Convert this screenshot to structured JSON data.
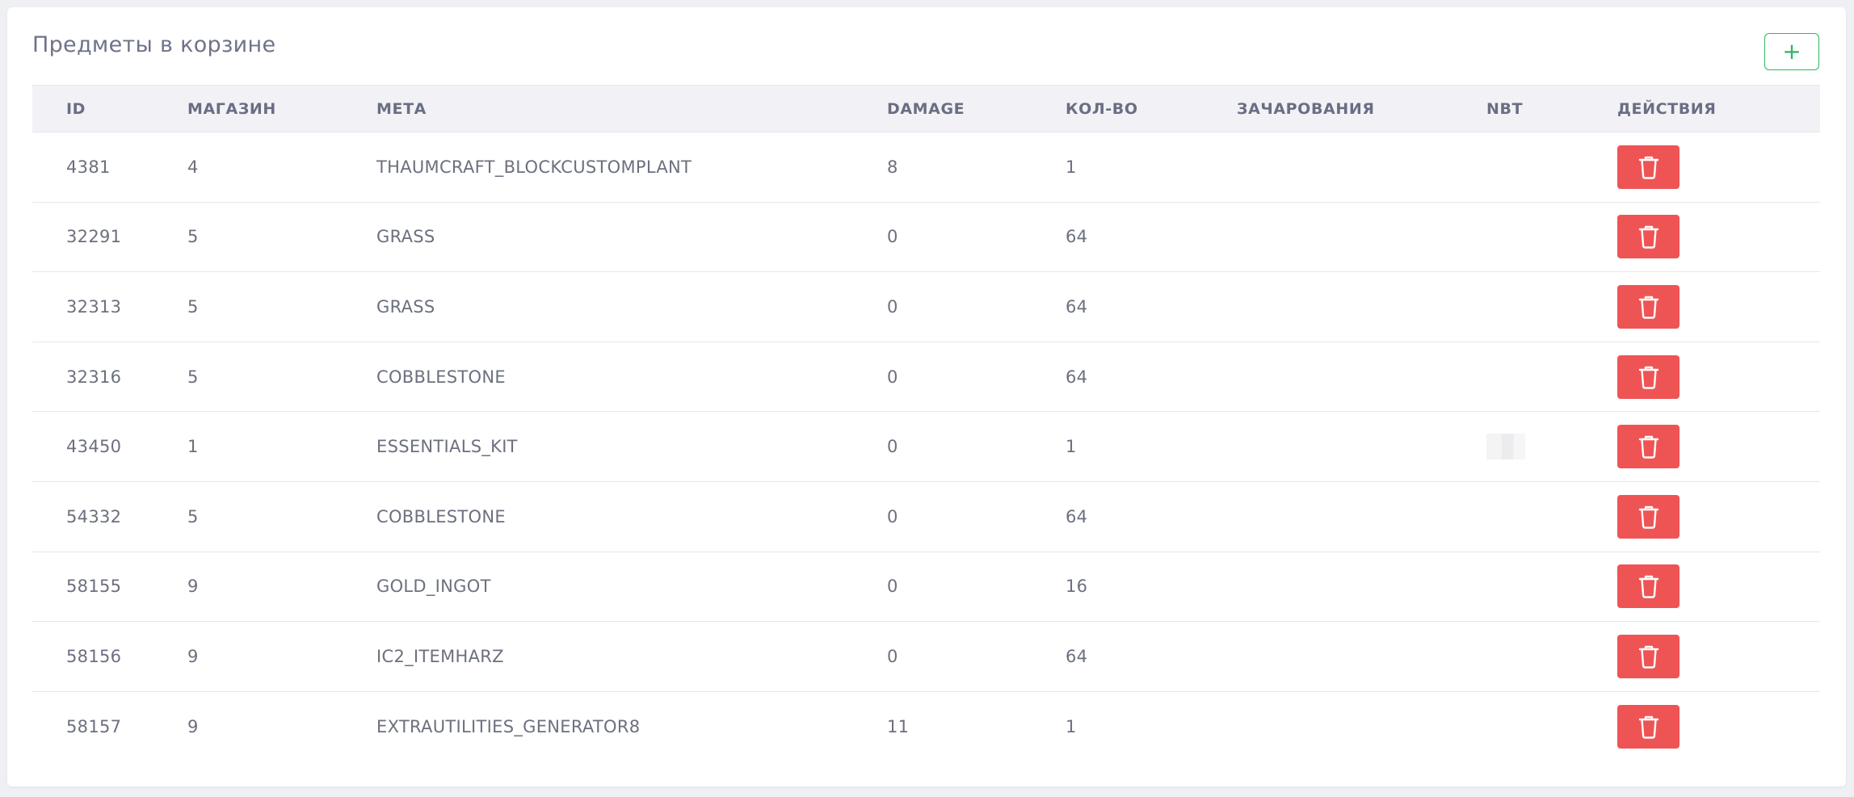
{
  "card": {
    "title": "Предметы в корзине",
    "add_button_label": "+"
  },
  "table": {
    "headers": [
      "ID",
      "МАГАЗИН",
      "МЕТА",
      "DAMAGE",
      "КОЛ-ВО",
      "ЗАЧАРОВАНИЯ",
      "NBT",
      "ДЕЙСТВИЯ"
    ],
    "rows": [
      {
        "id": "4381",
        "shop": "4",
        "meta": "THAUMCRAFT_BLOCKCUSTOMPLANT",
        "damage": "8",
        "qty": "1",
        "enchant": "",
        "nbt": ""
      },
      {
        "id": "32291",
        "shop": "5",
        "meta": "GRASS",
        "damage": "0",
        "qty": "64",
        "enchant": "",
        "nbt": ""
      },
      {
        "id": "32313",
        "shop": "5",
        "meta": "GRASS",
        "damage": "0",
        "qty": "64",
        "enchant": "",
        "nbt": ""
      },
      {
        "id": "32316",
        "shop": "5",
        "meta": "COBBLESTONE",
        "damage": "0",
        "qty": "64",
        "enchant": "",
        "nbt": ""
      },
      {
        "id": "43450",
        "shop": "1",
        "meta": "ESSENTIALS_KIT",
        "damage": "0",
        "qty": "1",
        "enchant": "",
        "nbt": "blurred"
      },
      {
        "id": "54332",
        "shop": "5",
        "meta": "COBBLESTONE",
        "damage": "0",
        "qty": "64",
        "enchant": "",
        "nbt": ""
      },
      {
        "id": "58155",
        "shop": "9",
        "meta": "GOLD_INGOT",
        "damage": "0",
        "qty": "16",
        "enchant": "",
        "nbt": ""
      },
      {
        "id": "58156",
        "shop": "9",
        "meta": "IC2_ITEMHARZ",
        "damage": "0",
        "qty": "64",
        "enchant": "",
        "nbt": ""
      },
      {
        "id": "58157",
        "shop": "9",
        "meta": "EXTRAUTILITIES_GENERATOR8",
        "damage": "11",
        "qty": "1",
        "enchant": "",
        "nbt": ""
      }
    ]
  },
  "icons": {
    "add": "plus-icon",
    "delete": "trash-icon"
  },
  "colors": {
    "accent_green": "#2fb565",
    "danger_red": "#ef5455",
    "header_bg": "#f2f2f6"
  }
}
